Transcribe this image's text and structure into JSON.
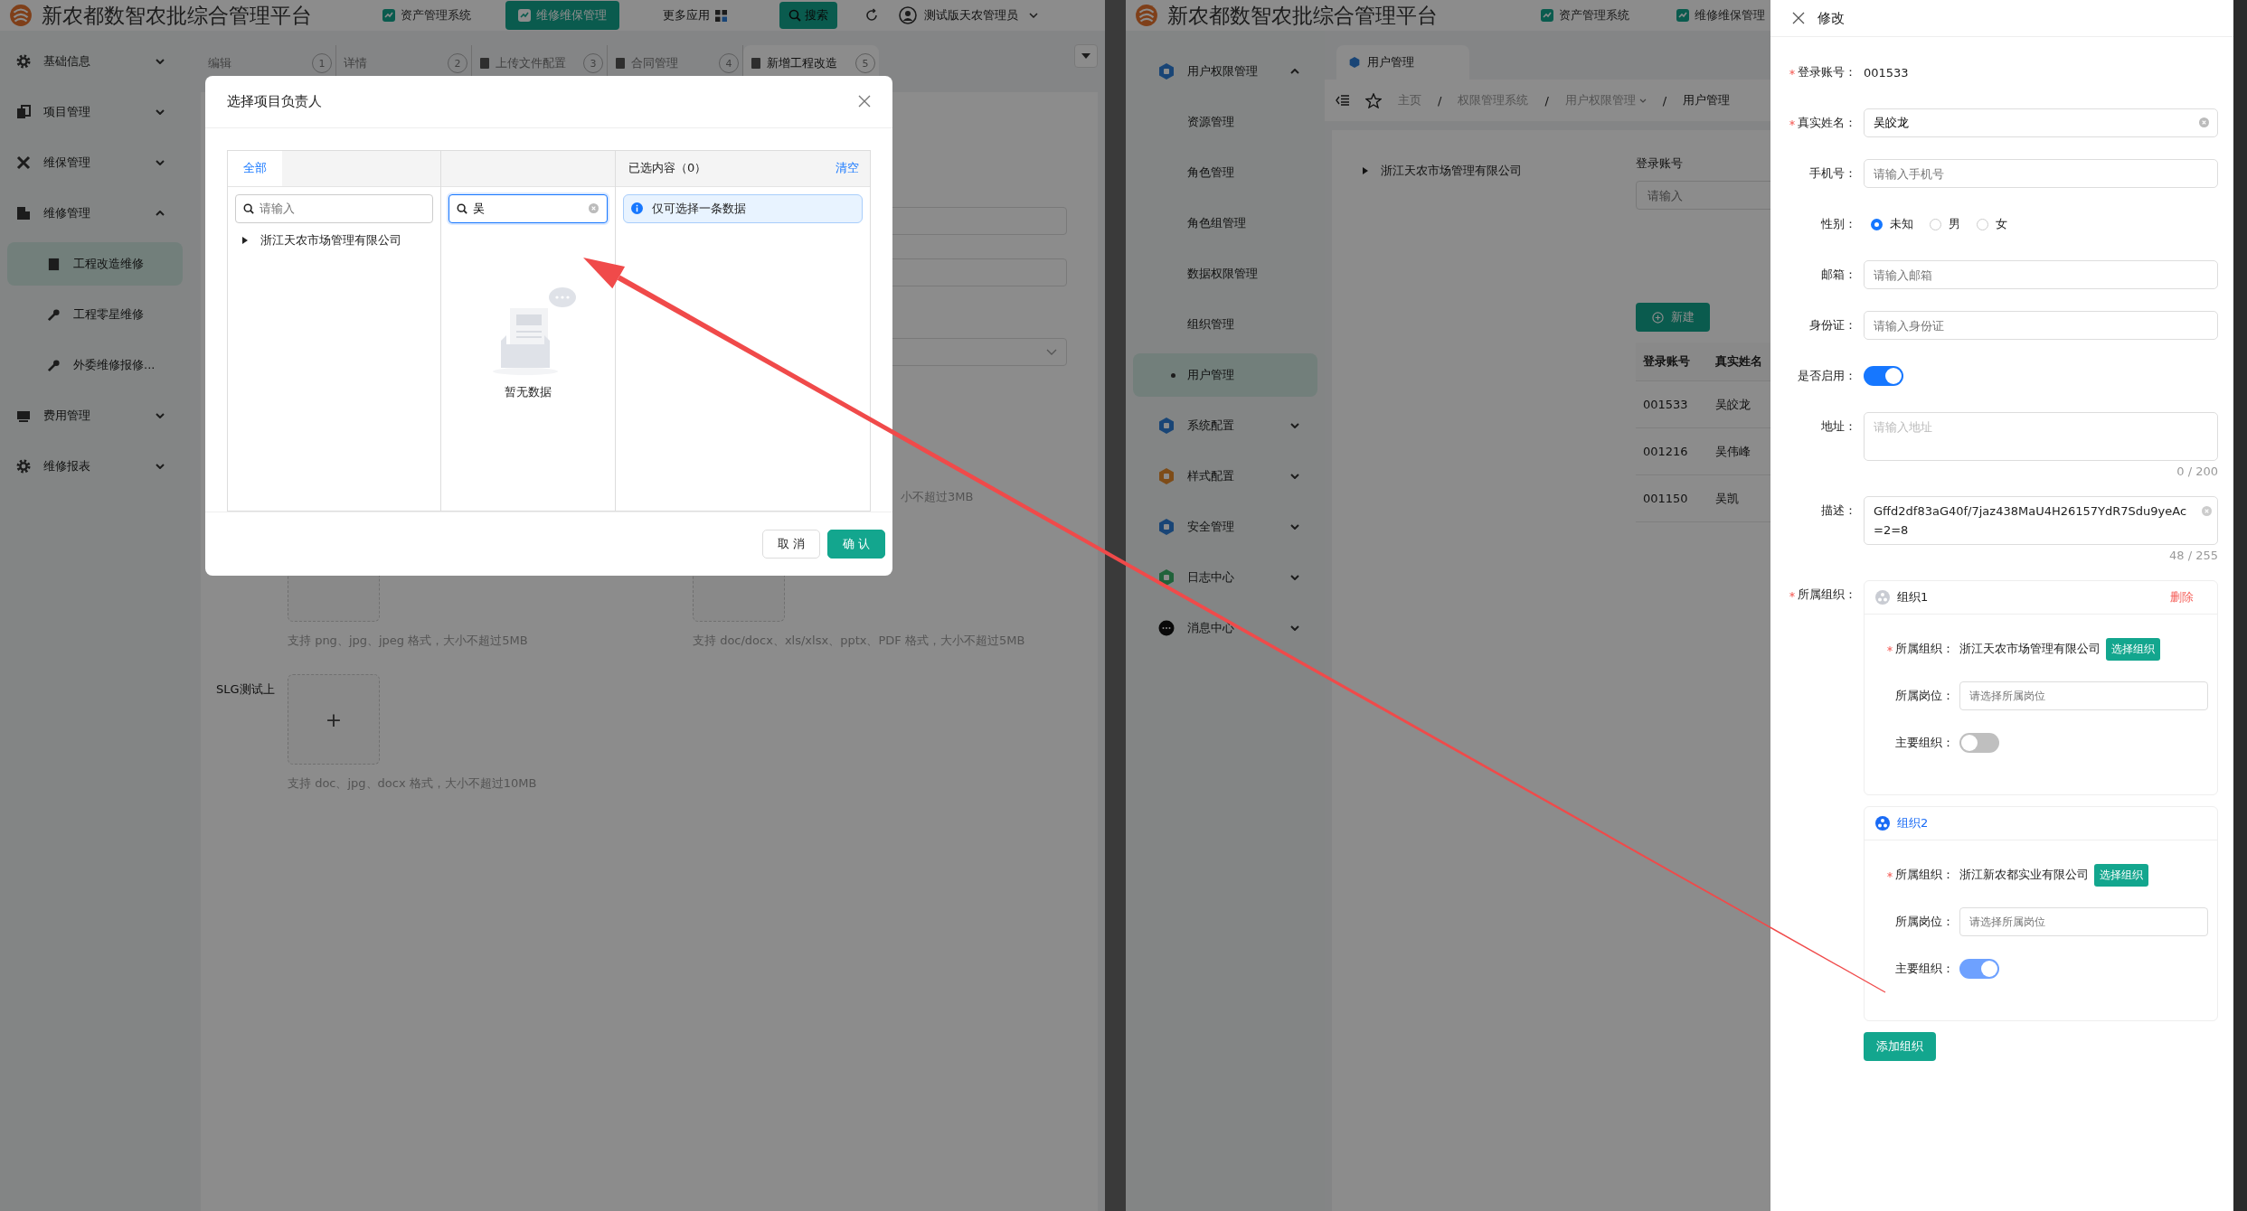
{
  "left_app": {
    "header": {
      "title": "新农都数智农批综合管理平台",
      "nav": [
        {
          "label": "资产管理系统",
          "selected": false
        },
        {
          "label": "维修维保管理",
          "selected": true
        }
      ],
      "more_apps": "更多应用",
      "search_button": "搜索",
      "user": "测试版天农管理员"
    },
    "sidebar": [
      {
        "label": "基础信息",
        "expanded": false
      },
      {
        "label": "项目管理",
        "expanded": false
      },
      {
        "label": "维保管理",
        "expanded": false
      },
      {
        "label": "维修管理",
        "expanded": true,
        "children": [
          {
            "label": "工程改造维修",
            "selected": true
          },
          {
            "label": "工程零星维修",
            "selected": false
          },
          {
            "label": "外委维修报修...",
            "selected": false
          }
        ]
      },
      {
        "label": "费用管理",
        "expanded": false
      },
      {
        "label": "维修报表",
        "expanded": false
      }
    ],
    "tabs": [
      {
        "label": "编辑",
        "number": "1",
        "selected": false
      },
      {
        "label": "详情",
        "number": "2",
        "selected": false
      },
      {
        "label": "上传文件配置",
        "number": "3",
        "selected": false
      },
      {
        "label": "合同管理",
        "number": "4",
        "selected": false
      },
      {
        "label": "新增工程改造",
        "number": "5",
        "selected": true
      }
    ],
    "form": {
      "partial_hint": "小不超过3MB",
      "uploads": [
        {
          "hint": "支持 png、jpg、jpeg 格式，大小不超过5MB"
        },
        {
          "hint": "支持 doc/docx、xls/xlsx、pptx、PDF 格式，大小不超过5MB"
        }
      ],
      "slg_upload": {
        "label": "SLG测试上",
        "plus": "+",
        "hint": "支持 doc、jpg、docx 格式，大小不超过10MB"
      }
    }
  },
  "modal": {
    "title": "选择项目负责人",
    "source_tab": {
      "label": "全部",
      "selected": true
    },
    "tree_search": {
      "placeholder": "请输入"
    },
    "tree": [
      {
        "label": "浙江天农市场管理有限公司",
        "expanded": false
      }
    ],
    "user_search": {
      "value": "吴"
    },
    "empty_text": "暂无数据",
    "selected_header": "已选内容（0）",
    "clear_link": "清空",
    "notice": "仅可选择一条数据",
    "buttons": [
      {
        "label": "取 消",
        "kind": "default"
      },
      {
        "label": "确 认",
        "kind": "primary"
      }
    ]
  },
  "right_app": {
    "header": {
      "title": "新农都数智农批综合管理平台",
      "nav": [
        {
          "label": "资产管理系统",
          "selected": false
        },
        {
          "label": "维修维保管理",
          "selected": false
        }
      ]
    },
    "sidebar": [
      {
        "label": "用户权限管理",
        "expanded": true,
        "children": [
          {
            "label": "资源管理",
            "selected": false
          },
          {
            "label": "角色管理",
            "selected": false
          },
          {
            "label": "角色组管理",
            "selected": false
          },
          {
            "label": "数据权限管理",
            "selected": false
          },
          {
            "label": "组织管理",
            "selected": false
          },
          {
            "label": "用户管理",
            "selected": true
          }
        ]
      },
      {
        "label": "系统配置",
        "expanded": false
      },
      {
        "label": "样式配置",
        "expanded": false
      },
      {
        "label": "安全管理",
        "expanded": false
      },
      {
        "label": "日志中心",
        "expanded": false
      },
      {
        "label": "消息中心",
        "expanded": false
      }
    ],
    "page_tab": {
      "label": "用户管理",
      "selected": true
    },
    "breadcrumb": [
      {
        "label": "主页",
        "dropdown": false
      },
      {
        "separator": "/",
        "label": "权限管理系统",
        "dropdown": false
      },
      {
        "separator": "/",
        "label": "用户权限管理",
        "dropdown": true
      },
      {
        "separator": "/",
        "label": "用户管理",
        "dropdown": false
      }
    ],
    "tree": [
      {
        "label": "浙江天农市场管理有限公司",
        "expanded": false
      }
    ],
    "filter": {
      "label": "登录账号",
      "placeholder": "请输入"
    },
    "new_button": "新建",
    "table": {
      "columns": [
        "登录账号",
        "真实姓名"
      ],
      "rows": [
        [
          "001533",
          "吴皎龙"
        ],
        [
          "001216",
          "吴伟峰"
        ],
        [
          "001150",
          "吴凯"
        ]
      ]
    }
  },
  "drawer": {
    "title": "修改",
    "fields": [
      {
        "kind": "text",
        "label": "登录账号：",
        "required": true,
        "value": "001533"
      },
      {
        "kind": "input",
        "label": "真实姓名：",
        "required": true,
        "value": "吴皎龙",
        "clearable": true
      },
      {
        "kind": "input",
        "label": "手机号：",
        "required": false,
        "placeholder": "请输入手机号",
        "clearable": false
      },
      {
        "kind": "radio",
        "label": "性别：",
        "required": false,
        "options": [
          {
            "label": "未知",
            "selected": true
          },
          {
            "label": "男",
            "selected": false
          },
          {
            "label": "女",
            "selected": false
          }
        ]
      },
      {
        "kind": "input",
        "label": "邮箱：",
        "required": false,
        "placeholder": "请输入邮箱",
        "clearable": false
      },
      {
        "kind": "input",
        "label": "身份证：",
        "required": false,
        "placeholder": "请输入身份证",
        "clearable": false
      },
      {
        "kind": "switch",
        "label": "是否启用：",
        "required": false,
        "on": true
      },
      {
        "kind": "textarea",
        "label": "地址：",
        "required": false,
        "placeholder": "请输入地址",
        "count": "0 / 200",
        "clearable": false
      },
      {
        "kind": "textarea",
        "label": "描述：",
        "required": false,
        "value": "Gffd2df83aG40f/7jaz438MaU4H26157YdR7Sdu9yeAc=2=8",
        "count": "48 / 255",
        "clearable": true
      }
    ],
    "organizations": {
      "label": "所属组织：",
      "required": true,
      "items": [
        {
          "title": "组织1",
          "active": false,
          "delete_label": "删除",
          "org_label": "所属组织：",
          "org_value": "浙江天农市场管理有限公司",
          "select_button": "选择组织",
          "post_label": "所属岗位：",
          "post_placeholder": "请选择所属岗位",
          "main_label": "主要组织：",
          "main": false
        },
        {
          "title": "组织2",
          "active": true,
          "org_label": "所属组织：",
          "org_value": "浙江新农都实业有限公司",
          "select_button": "选择组织",
          "post_label": "所属岗位：",
          "post_placeholder": "请选择所属岗位",
          "main_label": "主要组织：",
          "main": true
        }
      ]
    },
    "add_button": "添加组织"
  }
}
